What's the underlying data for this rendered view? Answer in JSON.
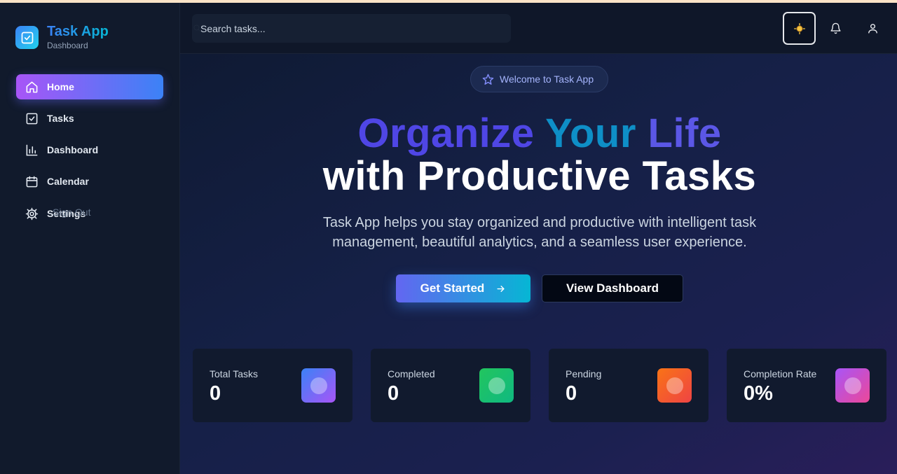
{
  "brand": {
    "title": "Task App",
    "subtitle": "Dashboard"
  },
  "sidebar": {
    "items": [
      {
        "label": "Home",
        "icon": "home-icon",
        "active": true
      },
      {
        "label": "Tasks",
        "icon": "check-square-icon"
      },
      {
        "label": "Dashboard",
        "icon": "bar-chart-icon"
      },
      {
        "label": "Calendar",
        "icon": "calendar-icon"
      },
      {
        "label": "Settings",
        "icon": "gear-icon"
      }
    ],
    "signout_label": "Sign Out"
  },
  "header": {
    "search_placeholder": "Search tasks...",
    "theme_icon": "sun-icon",
    "notification_icon": "bell-icon",
    "user_icon": "user-icon"
  },
  "hero": {
    "badge": "Welcome to Task App",
    "title_words": [
      "Organize",
      "Your",
      "Life"
    ],
    "title_line2": "with Productive Tasks",
    "description": "Task App helps you stay organized and productive with intelligent task management, beautiful analytics, and a seamless user experience.",
    "primary_button": "Get Started",
    "secondary_button": "View Dashboard"
  },
  "stats": [
    {
      "label": "Total Tasks",
      "value": "0",
      "gradient": [
        "#3b82f6",
        "#a855f7"
      ]
    },
    {
      "label": "Completed",
      "value": "0",
      "gradient": [
        "#22c55e",
        "#10b981"
      ]
    },
    {
      "label": "Pending",
      "value": "0",
      "gradient": [
        "#f97316",
        "#ef4444"
      ]
    },
    {
      "label": "Completion Rate",
      "value": "0%",
      "gradient": [
        "#a855f7",
        "#ec4899"
      ]
    }
  ],
  "colors": {
    "accent": "#6366f1",
    "cyan": "#06b6d4",
    "background": "#0f1729",
    "sidebar": "#111a2c"
  }
}
